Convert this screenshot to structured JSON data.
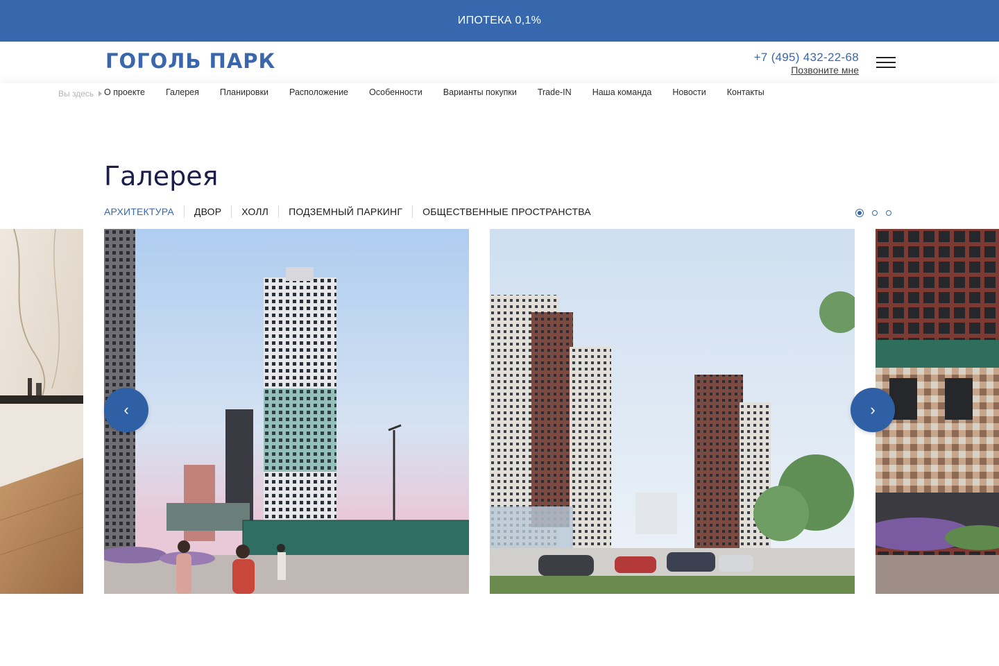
{
  "promo": {
    "text": "ИПОТЕКА 0,1%"
  },
  "header": {
    "logo": "ГОГОЛЬ ПАРК",
    "phone": "+7 (495) 432-22-68",
    "callback": "Позвоните мне",
    "menu_icon": "burger-menu-icon"
  },
  "nav": {
    "you_are_here": "Вы здесь",
    "items": [
      {
        "label": "О проекте"
      },
      {
        "label": "Галерея"
      },
      {
        "label": "Планировки"
      },
      {
        "label": "Расположение"
      },
      {
        "label": "Особенности"
      },
      {
        "label": "Варианты покупки"
      },
      {
        "label": "Trade-IN"
      },
      {
        "label": "Наша команда"
      },
      {
        "label": "Новости"
      },
      {
        "label": "Контакты"
      }
    ]
  },
  "gallery": {
    "title": "Галерея",
    "tabs": [
      {
        "label": "АРХИТЕКТУРА",
        "active": true
      },
      {
        "label": "ДВОР"
      },
      {
        "label": "ХОЛЛ"
      },
      {
        "label": "ПОДЗЕМНЫЙ ПАРКИНГ"
      },
      {
        "label": "ОБЩЕСТВЕННЫЕ ПРОСТРАНСТВА"
      }
    ],
    "pager": {
      "pages": 3,
      "current": 1
    },
    "arrows": {
      "prev": "‹",
      "next": "›"
    },
    "slides": [
      {
        "subject": "interior-marble-kitchen"
      },
      {
        "subject": "tower-evening-street"
      },
      {
        "subject": "residential-towers-parking"
      },
      {
        "subject": "facade-closeup-garden"
      }
    ]
  },
  "colors": {
    "brand_blue": "#3768ad",
    "arrow_blue": "#2f5fa4",
    "title_navy": "#1d1d4a"
  }
}
